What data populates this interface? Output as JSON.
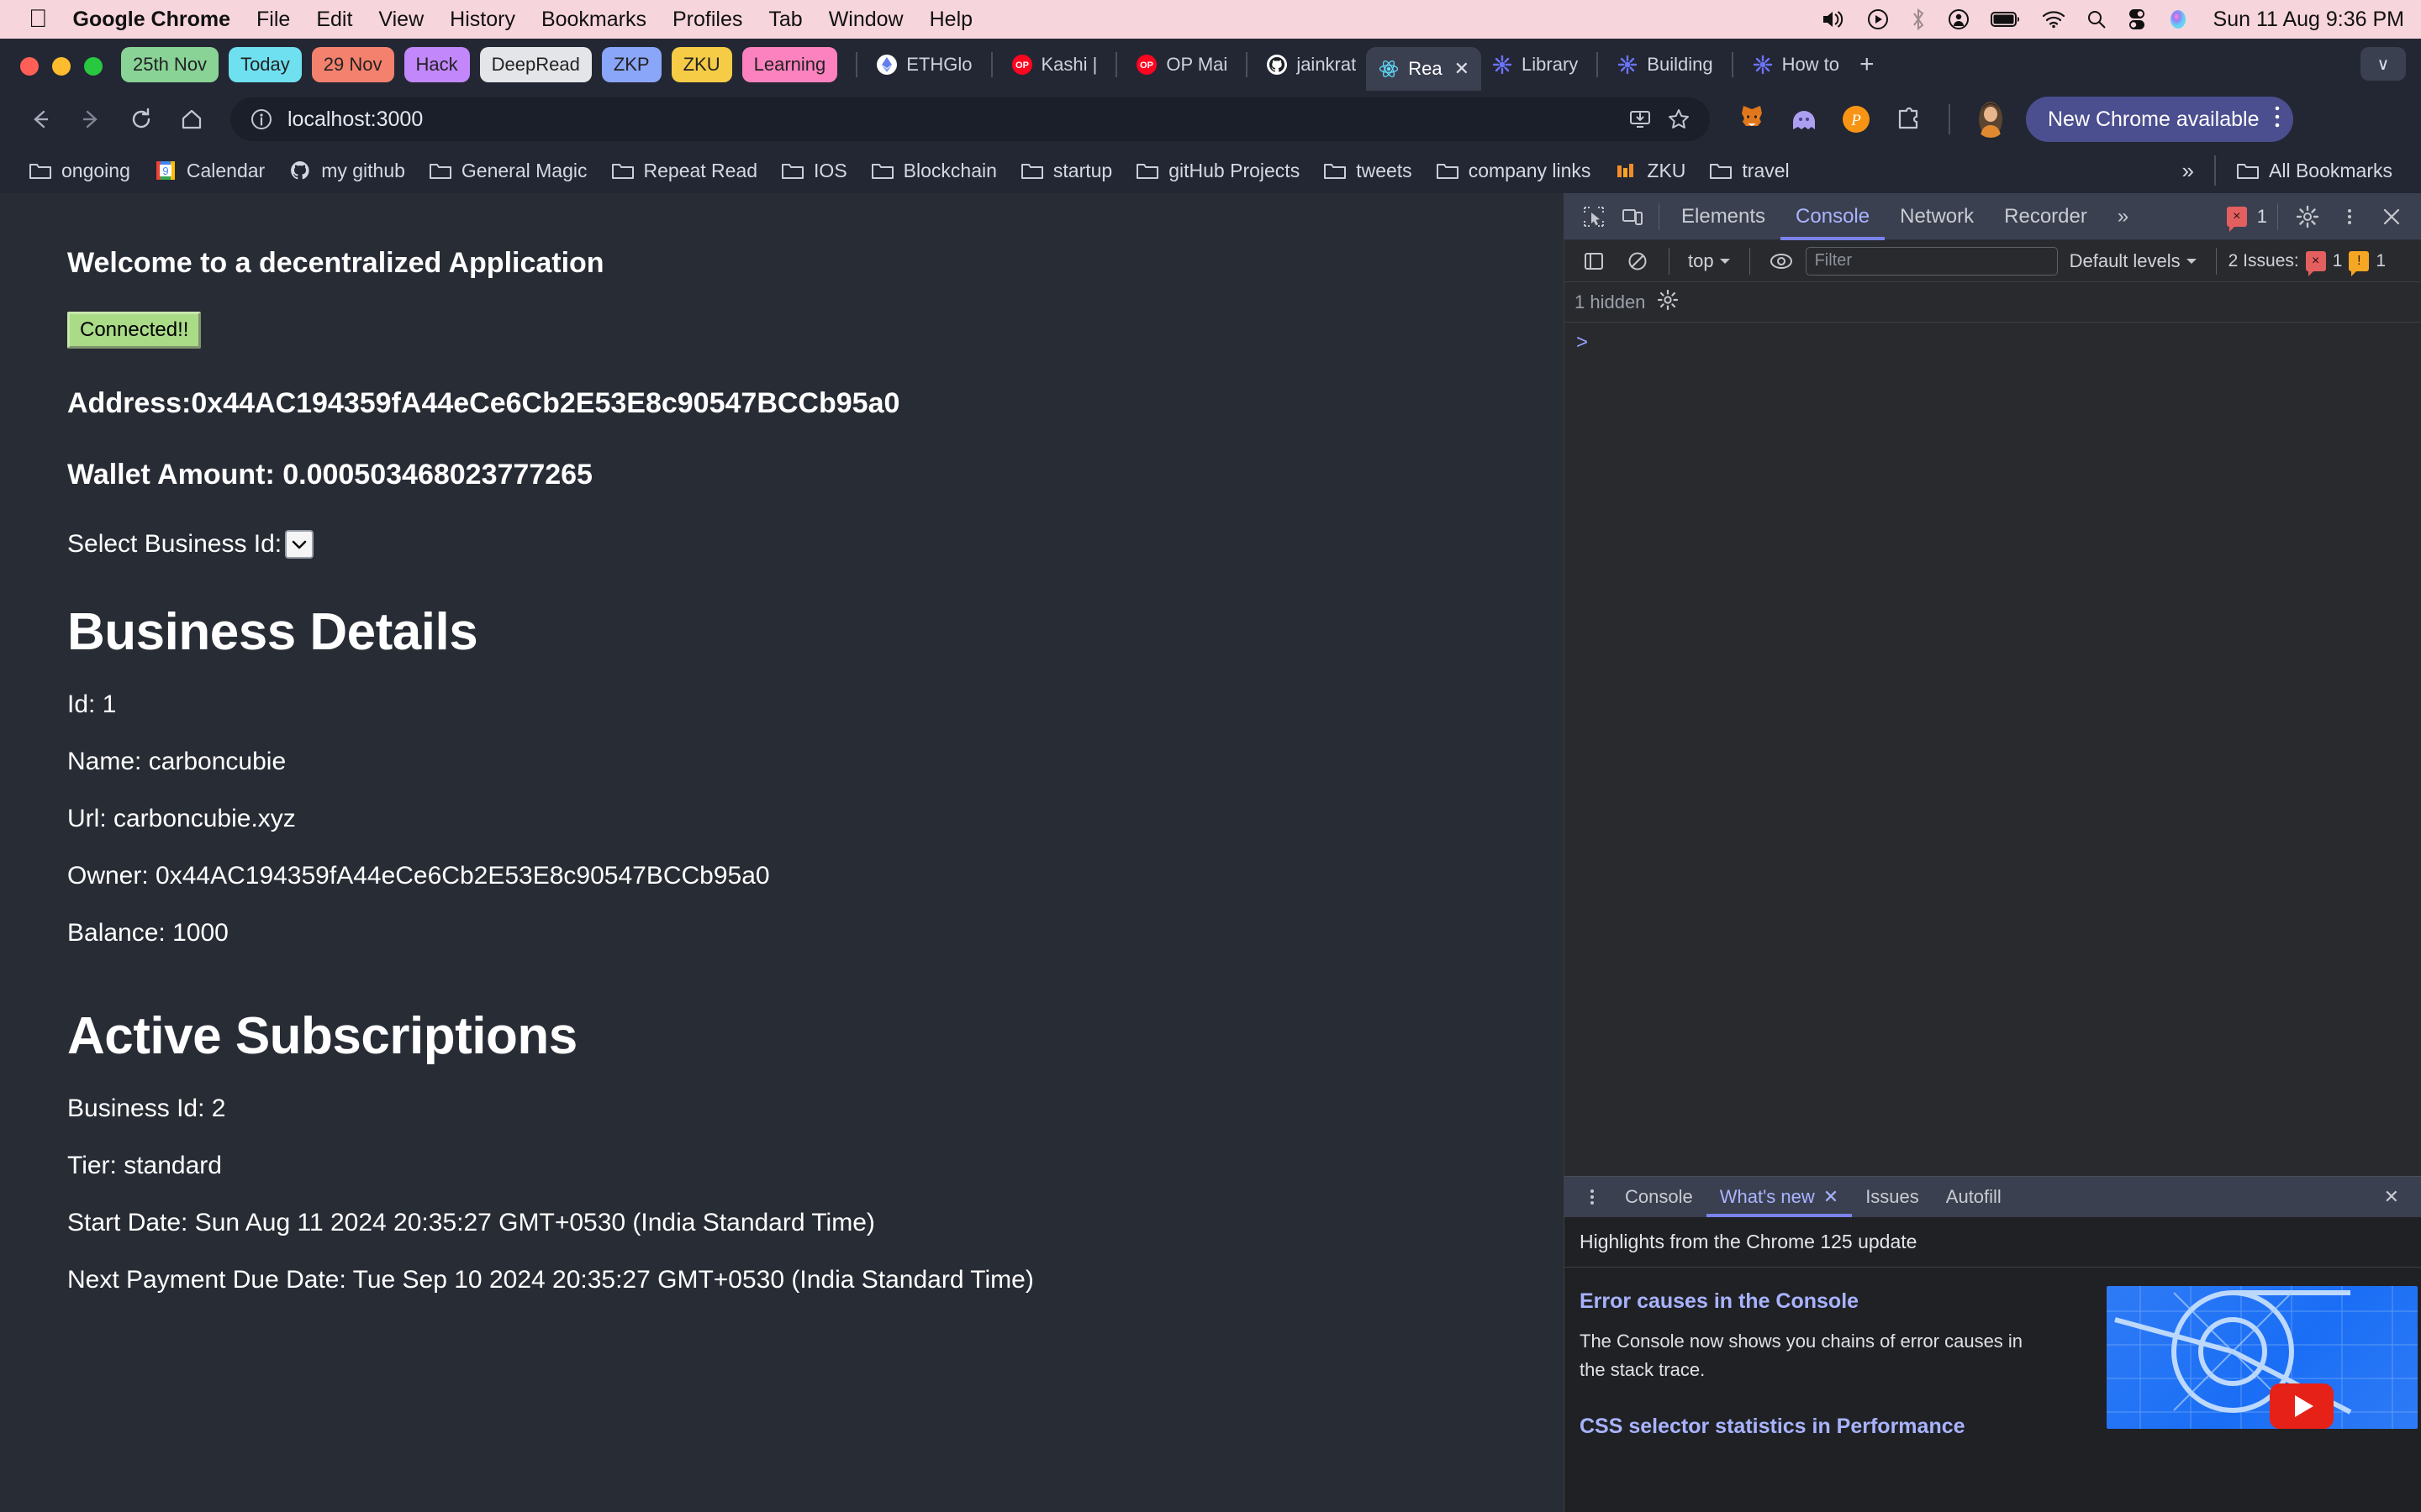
{
  "macos": {
    "app_name": "Google Chrome",
    "menus": [
      "File",
      "Edit",
      "View",
      "History",
      "Bookmarks",
      "Profiles",
      "Tab",
      "Window",
      "Help"
    ],
    "status_icons": [
      "volume-icon",
      "play-circle-icon",
      "bluetooth-icon",
      "user-circle-icon",
      "battery-icon",
      "wifi-icon",
      "search-icon",
      "control-center-icon",
      "siri-icon"
    ],
    "clock": "Sun 11 Aug  9:36 PM"
  },
  "browser": {
    "tab_groups": [
      {
        "label": "25th Nov",
        "color": "#89d397"
      },
      {
        "label": "Today",
        "color": "#6fe0ef"
      },
      {
        "label": "29 Nov",
        "color": "#f4816e"
      },
      {
        "label": "Hack",
        "color": "#c187fb"
      },
      {
        "label": "DeepRead",
        "color": "#e3e5e8"
      },
      {
        "label": "ZKP",
        "color": "#8aa6f8"
      },
      {
        "label": "ZKU",
        "color": "#f6cc46"
      },
      {
        "label": "Learning",
        "color": "#fc82bf"
      }
    ],
    "tabs": [
      {
        "label": "ETHGlo",
        "icon": "ethglobal-icon",
        "active": false
      },
      {
        "label": "Kashi |",
        "icon": "op-icon",
        "active": false
      },
      {
        "label": "OP Mai",
        "icon": "op-icon",
        "active": false
      },
      {
        "label": "jainkrat",
        "icon": "github-icon",
        "active": false
      },
      {
        "label": "Rea",
        "icon": "react-icon",
        "active": true
      },
      {
        "label": "Library",
        "icon": "notion-loading-icon",
        "active": false
      },
      {
        "label": "Building",
        "icon": "notion-loading-icon",
        "active": false
      },
      {
        "label": "How to",
        "icon": "notion-loading-icon",
        "active": false
      }
    ],
    "new_tab_label": "+",
    "tab_close_label": "✕",
    "tablist_chevron": "∨",
    "toolbar": {
      "back_icon": "back-arrow-icon",
      "forward_icon": "forward-arrow-icon",
      "reload_icon": "reload-icon",
      "home_icon": "home-icon",
      "site_info_icon": "info-circle-icon",
      "url": "localhost:3000",
      "install_icon": "install-app-icon",
      "bookmark_icon": "star-icon",
      "extensions": [
        "metamask-icon",
        "phantom-icon",
        "polkadot-icon",
        "puzzle-extensions-icon"
      ],
      "avatar": "profile-avatar",
      "update_label": "New Chrome available",
      "menu_icon": "three-dot-menu-icon"
    },
    "bookmarks": [
      {
        "label": "ongoing",
        "icon": "folder-icon"
      },
      {
        "label": "Calendar",
        "icon": "google-calendar-icon"
      },
      {
        "label": "my github",
        "icon": "github-icon"
      },
      {
        "label": "General Magic",
        "icon": "folder-icon"
      },
      {
        "label": "Repeat Read",
        "icon": "folder-icon"
      },
      {
        "label": "IOS",
        "icon": "folder-icon"
      },
      {
        "label": "Blockchain",
        "icon": "folder-icon"
      },
      {
        "label": "startup",
        "icon": "folder-icon"
      },
      {
        "label": "gitHub Projects",
        "icon": "folder-icon"
      },
      {
        "label": "tweets",
        "icon": "folder-icon"
      },
      {
        "label": "company links",
        "icon": "folder-icon"
      },
      {
        "label": "ZKU",
        "icon": "zku-icon"
      },
      {
        "label": "travel",
        "icon": "folder-icon"
      }
    ],
    "bookmarks_overflow": "»",
    "all_bookmarks_label": "All Bookmarks"
  },
  "page": {
    "heading": "Welcome to a decentralized Application",
    "connect_button": "Connected!!",
    "address_line": "Address:0x44AC194359fA44eCe6Cb2E53E8c90547BCCb95a0",
    "wallet_line": "Wallet Amount: 0.000503468023777265",
    "select_label": "Select Business Id:",
    "select_value": "",
    "business": {
      "title": "Business Details",
      "rows": [
        "Id: 1",
        "Name: carboncubie",
        "Url: carboncubie.xyz",
        "Owner: 0x44AC194359fA44eCe6Cb2E53E8c90547BCCb95a0",
        "Balance: 1000"
      ]
    },
    "subscriptions": {
      "title": "Active Subscriptions",
      "rows": [
        "Business Id: 2",
        "Tier: standard",
        "Start Date: Sun Aug 11 2024 20:35:27 GMT+0530 (India Standard Time)",
        "Next Payment Due Date: Tue Sep 10 2024 20:35:27 GMT+0530 (India Standard Time)"
      ]
    }
  },
  "devtools": {
    "inspect_icon": "inspect-element-icon",
    "device_icon": "device-toolbar-icon",
    "tabs": [
      "Elements",
      "Console",
      "Network",
      "Recorder"
    ],
    "active_tab": "Console",
    "more_tabs": "»",
    "error_count": "1",
    "settings_icon": "gear-icon",
    "more_icon": "three-dot-menu-icon",
    "close_icon": "close-icon",
    "sidebar_icon": "show-sidebar-icon",
    "clear_icon": "clear-console-icon",
    "context": "top",
    "eye_icon": "live-expression-icon",
    "filter_placeholder": "Filter",
    "filter_value": "",
    "levels_label": "Default levels",
    "issues_label": "2 Issues:",
    "issues_error_count": "1",
    "issues_warning_count": "1",
    "hidden_label": "1 hidden",
    "hidden_gear_icon": "gear-icon",
    "prompt": ">",
    "drawer": {
      "menu_icon": "three-dot-menu-icon",
      "tabs": [
        "Console",
        "What's new",
        "Issues",
        "Autofill"
      ],
      "active_tab": "What's new",
      "tab_close_icon": "✕",
      "close_icon": "✕",
      "headline": "Highlights from the Chrome 125 update",
      "items": [
        {
          "title": "Error causes in the Console",
          "body": "The Console now shows you chains of error causes in the stack trace."
        },
        {
          "title": "CSS selector statistics in Performance",
          "body": ""
        }
      ],
      "thumbnail": "chrome-devtools-video-thumbnail"
    }
  },
  "colors": {
    "menubar_bg": "#f7d5dc",
    "chrome_bg": "#232733",
    "page_bg": "#282c35",
    "devtools_bg": "#282a2e",
    "accent": "#7b83eb",
    "update_pill": "#4b4e8f"
  }
}
